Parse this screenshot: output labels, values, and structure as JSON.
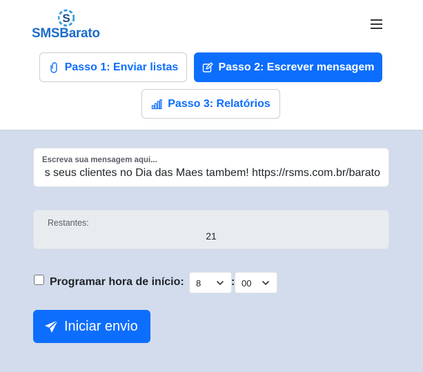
{
  "brand": {
    "name": "SMSBarato",
    "logo_glyph": "S"
  },
  "nav": {
    "menu_icon": "hamburger-menu-icon"
  },
  "steps": [
    {
      "label": "Passo 1: Enviar listas",
      "icon": "paperclip-icon"
    },
    {
      "label": "Passo 2: Escrever mensagem",
      "icon": "pencil-square-icon"
    },
    {
      "label": "Passo 3: Relatórios",
      "icon": "bar-chart-icon"
    }
  ],
  "message": {
    "label": "Escreva sua mensagem aqui...",
    "value": "s seus clientes no Dia das Maes tambem! https://rsms.com.br/barato"
  },
  "remaining": {
    "label": "Restantes:",
    "value": "21"
  },
  "schedule": {
    "label": "Programar hora de início:",
    "checked": false,
    "hour": "8",
    "separator": ":",
    "minute": "00"
  },
  "start": {
    "label": "Iniciar envio",
    "icon": "send-icon"
  },
  "colors": {
    "primary": "#0d6efd",
    "brand": "#1c6dc9",
    "background": "#d3dcec"
  }
}
